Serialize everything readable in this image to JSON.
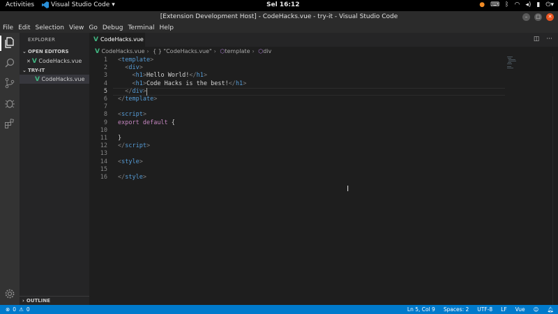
{
  "topbar": {
    "activities": "Activities",
    "app_name": "Visual Studio Code",
    "app_dropdown": "▾",
    "clock": "Sel 16:12"
  },
  "window": {
    "title": "[Extension Development Host] - CodeHacks.vue - try-it - Visual Studio Code",
    "minimize": "–",
    "maximize": "□",
    "close": "✕"
  },
  "menu": [
    "File",
    "Edit",
    "Selection",
    "View",
    "Go",
    "Debug",
    "Terminal",
    "Help"
  ],
  "activity_icons": [
    "files-icon",
    "search-icon",
    "source-control-icon",
    "debug-icon",
    "extensions-icon",
    "settings-gear-icon"
  ],
  "sidebar": {
    "title": "EXPLORER",
    "open_editors": "OPEN EDITORS",
    "open_editor_close": "✕",
    "open_file": "CodeHacks.vue",
    "folder": "TRY-IT",
    "file": "CodeHacks.vue",
    "outline": "OUTLINE"
  },
  "editor": {
    "tab_label": "CodeHacks.vue",
    "breadcrumbs": [
      "CodeHacks.vue",
      "{ } \"CodeHacks.vue\"",
      "template",
      "div"
    ],
    "lines": [
      {
        "n": "1",
        "tokens": [
          {
            "c": "tk-tag",
            "t": "<"
          },
          {
            "c": "tk-name",
            "t": "template"
          },
          {
            "c": "tk-tag",
            "t": ">"
          }
        ]
      },
      {
        "n": "2",
        "tokens": [
          {
            "c": "tk-text",
            "t": "  "
          },
          {
            "c": "tk-tag",
            "t": "<"
          },
          {
            "c": "tk-name",
            "t": "div"
          },
          {
            "c": "tk-tag",
            "t": ">"
          }
        ]
      },
      {
        "n": "3",
        "tokens": [
          {
            "c": "tk-text",
            "t": "    "
          },
          {
            "c": "tk-tag",
            "t": "<"
          },
          {
            "c": "tk-name",
            "t": "h1"
          },
          {
            "c": "tk-tag",
            "t": ">"
          },
          {
            "c": "tk-text",
            "t": "Hello World!"
          },
          {
            "c": "tk-tag",
            "t": "</"
          },
          {
            "c": "tk-name",
            "t": "h1"
          },
          {
            "c": "tk-tag",
            "t": ">"
          }
        ]
      },
      {
        "n": "4",
        "tokens": [
          {
            "c": "tk-text",
            "t": "    "
          },
          {
            "c": "tk-tag",
            "t": "<"
          },
          {
            "c": "tk-name",
            "t": "h1"
          },
          {
            "c": "tk-tag",
            "t": ">"
          },
          {
            "c": "tk-text",
            "t": "Code Hacks is the best!"
          },
          {
            "c": "tk-tag",
            "t": "</"
          },
          {
            "c": "tk-name",
            "t": "h1"
          },
          {
            "c": "tk-tag",
            "t": ">"
          }
        ]
      },
      {
        "n": "5",
        "tokens": [
          {
            "c": "tk-text",
            "t": "  "
          },
          {
            "c": "tk-tag",
            "t": "</"
          },
          {
            "c": "tk-name",
            "t": "div"
          },
          {
            "c": "tk-tag",
            "t": ">"
          }
        ]
      },
      {
        "n": "6",
        "tokens": [
          {
            "c": "tk-tag",
            "t": "</"
          },
          {
            "c": "tk-name",
            "t": "template"
          },
          {
            "c": "tk-tag",
            "t": ">"
          }
        ]
      },
      {
        "n": "7",
        "tokens": []
      },
      {
        "n": "8",
        "tokens": [
          {
            "c": "tk-tag",
            "t": "<"
          },
          {
            "c": "tk-name",
            "t": "script"
          },
          {
            "c": "tk-tag",
            "t": ">"
          }
        ]
      },
      {
        "n": "9",
        "tokens": [
          {
            "c": "tk-kw",
            "t": "export"
          },
          {
            "c": "tk-text",
            "t": " "
          },
          {
            "c": "tk-kw",
            "t": "default"
          },
          {
            "c": "tk-text",
            "t": " {"
          }
        ]
      },
      {
        "n": "10",
        "tokens": []
      },
      {
        "n": "11",
        "tokens": [
          {
            "c": "tk-text",
            "t": "}"
          }
        ]
      },
      {
        "n": "12",
        "tokens": [
          {
            "c": "tk-tag",
            "t": "</"
          },
          {
            "c": "tk-name",
            "t": "script"
          },
          {
            "c": "tk-tag",
            "t": ">"
          }
        ]
      },
      {
        "n": "13",
        "tokens": []
      },
      {
        "n": "14",
        "tokens": [
          {
            "c": "tk-tag",
            "t": "<"
          },
          {
            "c": "tk-name",
            "t": "style"
          },
          {
            "c": "tk-tag",
            "t": ">"
          }
        ]
      },
      {
        "n": "15",
        "tokens": []
      },
      {
        "n": "16",
        "tokens": [
          {
            "c": "tk-tag",
            "t": "</"
          },
          {
            "c": "tk-name",
            "t": "style"
          },
          {
            "c": "tk-tag",
            "t": ">"
          }
        ]
      }
    ],
    "current_line": "5"
  },
  "status": {
    "errors": "0",
    "warnings": "0",
    "position": "Ln 5, Col 9",
    "spaces": "Spaces: 2",
    "encoding": "UTF-8",
    "eol": "LF",
    "language": "Vue"
  },
  "colors": {
    "accent": "#007acc",
    "vue": "#41b883",
    "ubuntu_orange": "#e95420"
  }
}
